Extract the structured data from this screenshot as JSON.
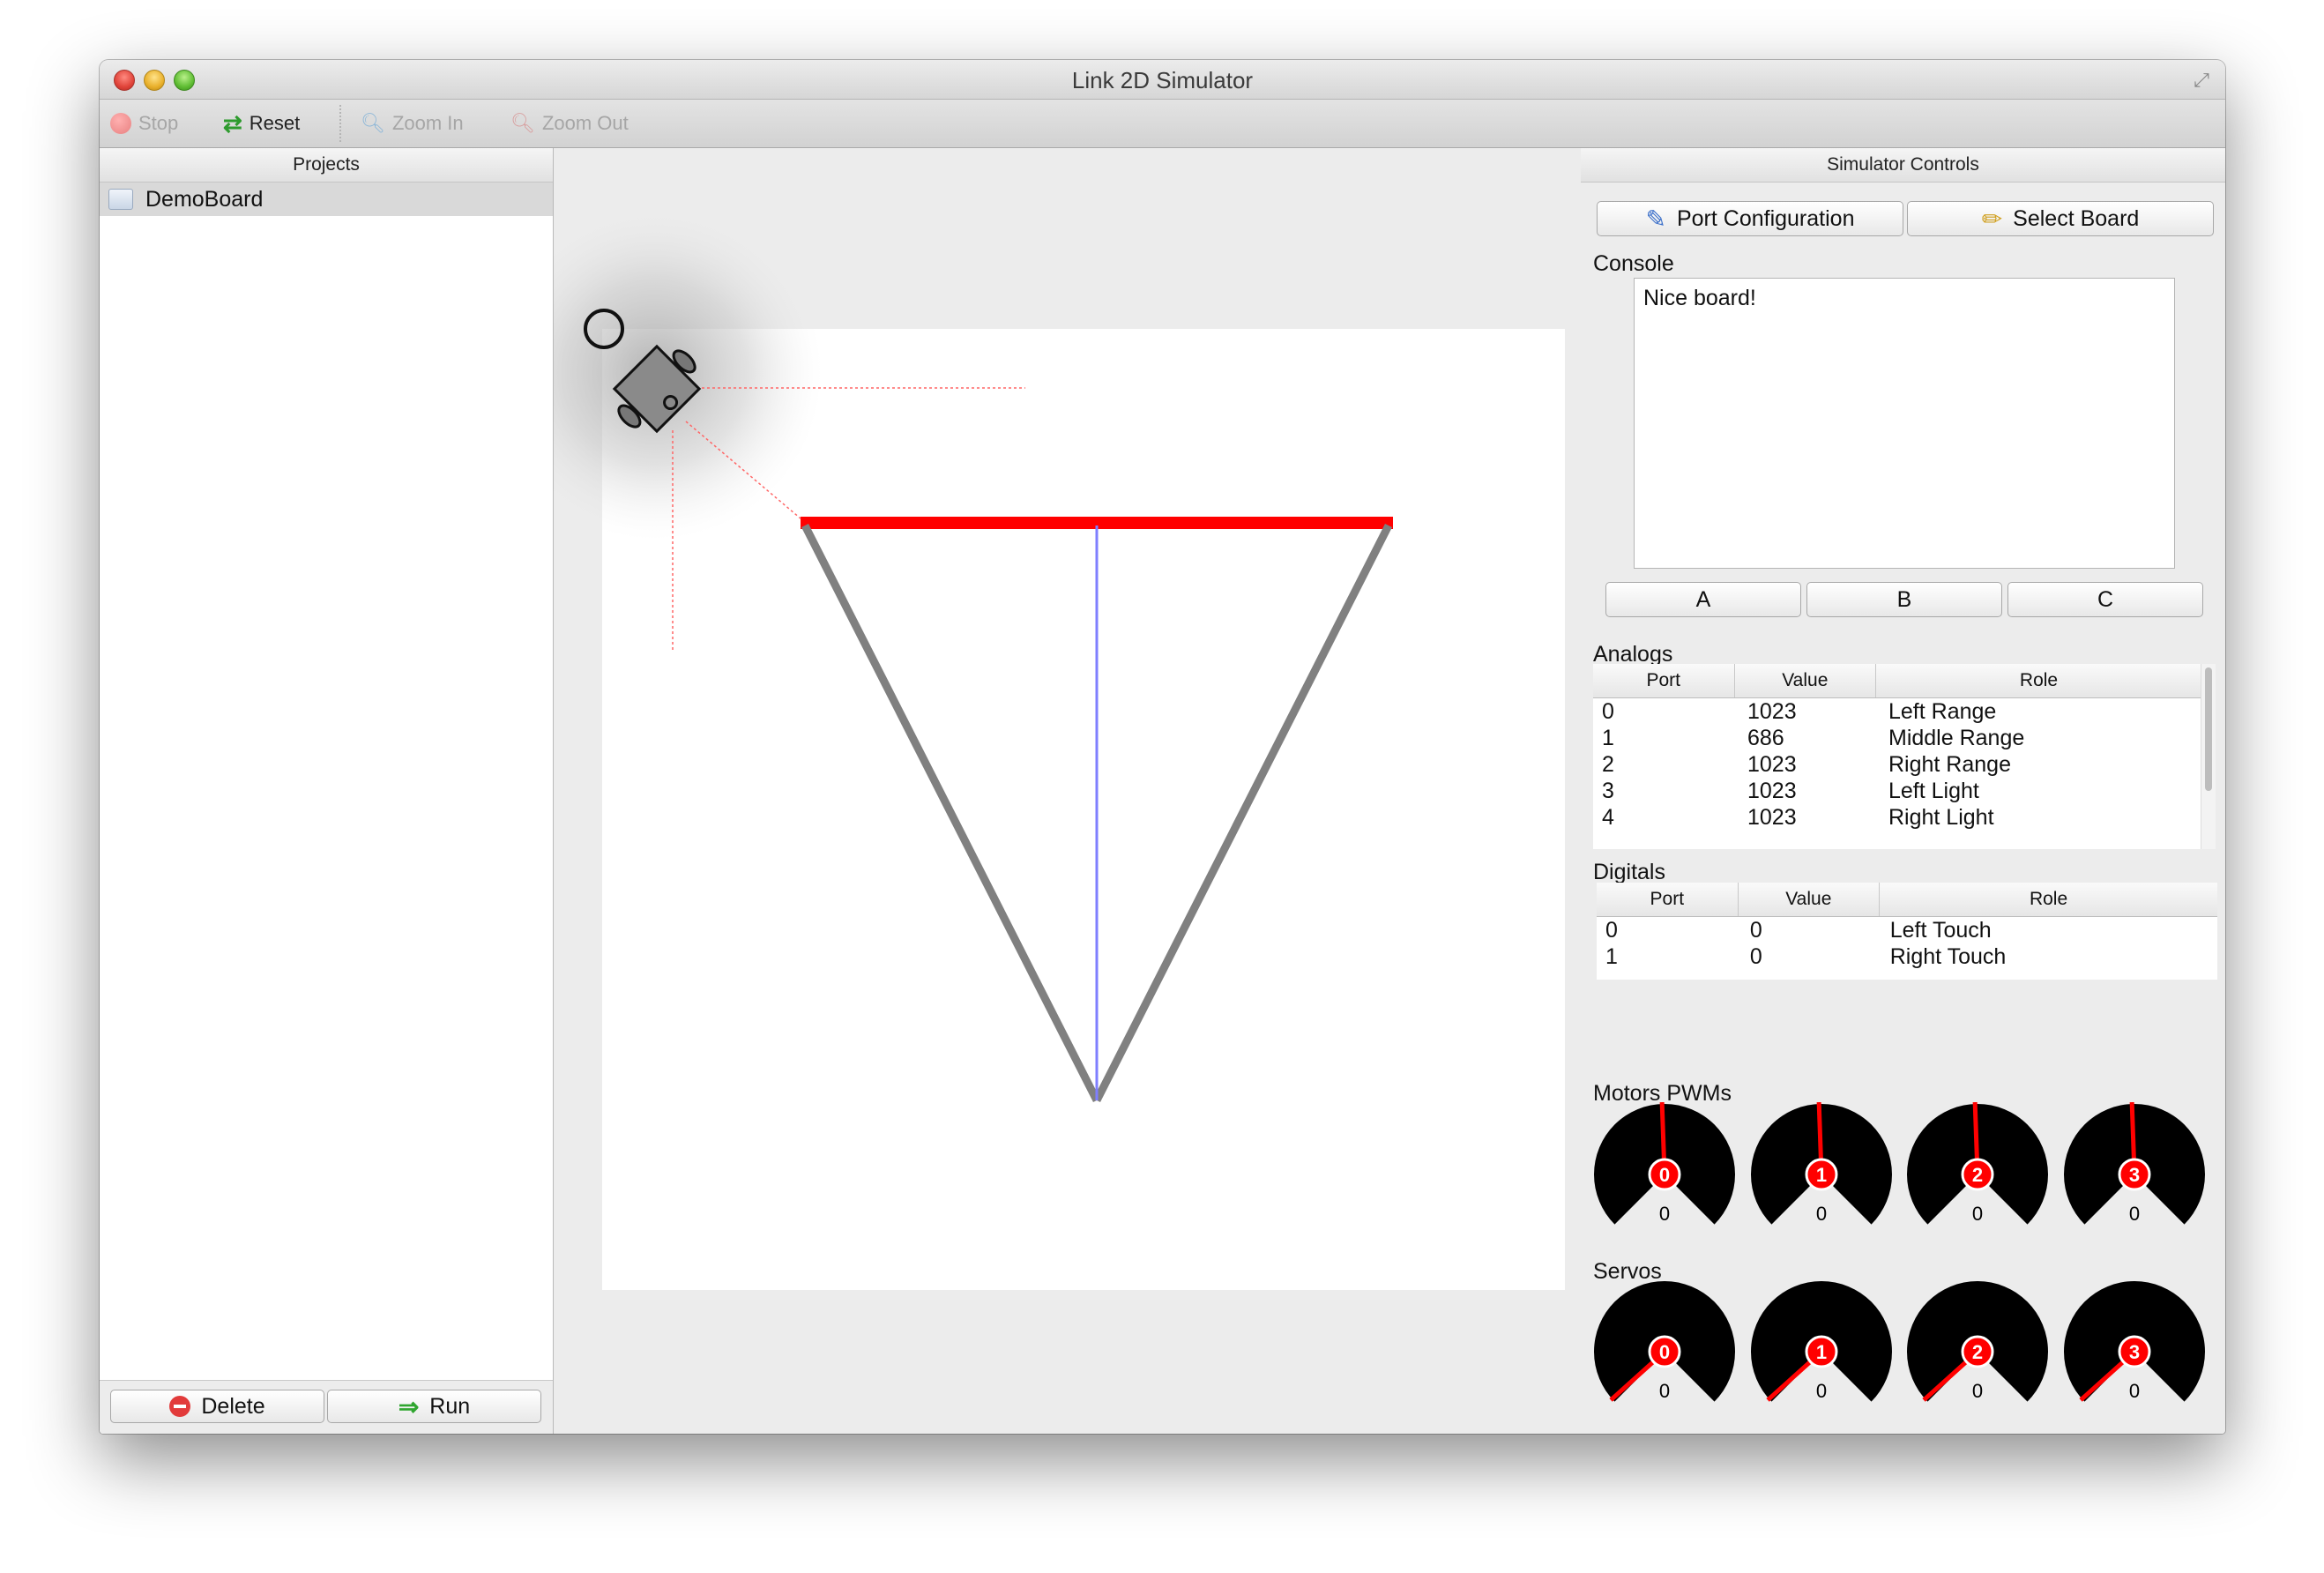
{
  "window": {
    "title": "Link 2D Simulator"
  },
  "toolbar": {
    "stop": {
      "label": "Stop",
      "icon": "stop-icon",
      "enabled": false
    },
    "reset": {
      "label": "Reset",
      "icon": "reset-icon",
      "enabled": true
    },
    "zoom_in": {
      "label": "Zoom In",
      "icon": "zoom-in-icon",
      "enabled": false
    },
    "zoom_out": {
      "label": "Zoom Out",
      "icon": "zoom-out-icon",
      "enabled": false
    }
  },
  "projects": {
    "header": "Projects",
    "items": [
      {
        "label": "DemoBoard",
        "icon": "project-icon",
        "selected": true
      }
    ],
    "delete_label": "Delete",
    "run_label": "Run"
  },
  "controls": {
    "header": "Simulator Controls",
    "port_config_label": "Port Configuration",
    "select_board_label": "Select Board",
    "console_label": "Console",
    "console_text": "Nice board!",
    "buttons": [
      "A",
      "B",
      "C"
    ]
  },
  "analogs": {
    "label": "Analogs",
    "columns": [
      "Port",
      "Value",
      "Role"
    ],
    "rows": [
      [
        "0",
        "1023",
        "Left Range"
      ],
      [
        "1",
        "686",
        "Middle Range"
      ],
      [
        "2",
        "1023",
        "Right Range"
      ],
      [
        "3",
        "1023",
        "Left Light"
      ],
      [
        "4",
        "1023",
        "Right Light"
      ]
    ]
  },
  "digitals": {
    "label": "Digitals",
    "columns": [
      "Port",
      "Value",
      "Role"
    ],
    "rows": [
      [
        "0",
        "0",
        "Left Touch"
      ],
      [
        "1",
        "0",
        "Right Touch"
      ]
    ]
  },
  "motors": {
    "label": "Motors PWMs",
    "gauges": [
      {
        "id": "0",
        "value": "0"
      },
      {
        "id": "1",
        "value": "0"
      },
      {
        "id": "2",
        "value": "0"
      },
      {
        "id": "3",
        "value": "0"
      }
    ]
  },
  "servos": {
    "label": "Servos",
    "gauges": [
      {
        "id": "0",
        "value": "0"
      },
      {
        "id": "1",
        "value": "0"
      },
      {
        "id": "2",
        "value": "0"
      },
      {
        "id": "3",
        "value": "0"
      }
    ]
  },
  "colors": {
    "wall_red": "#ff0000",
    "wall_gray": "#808080",
    "sensor_blue": "#7f7fff",
    "needle_red": "#ff0000",
    "gauge_black": "#000000"
  }
}
